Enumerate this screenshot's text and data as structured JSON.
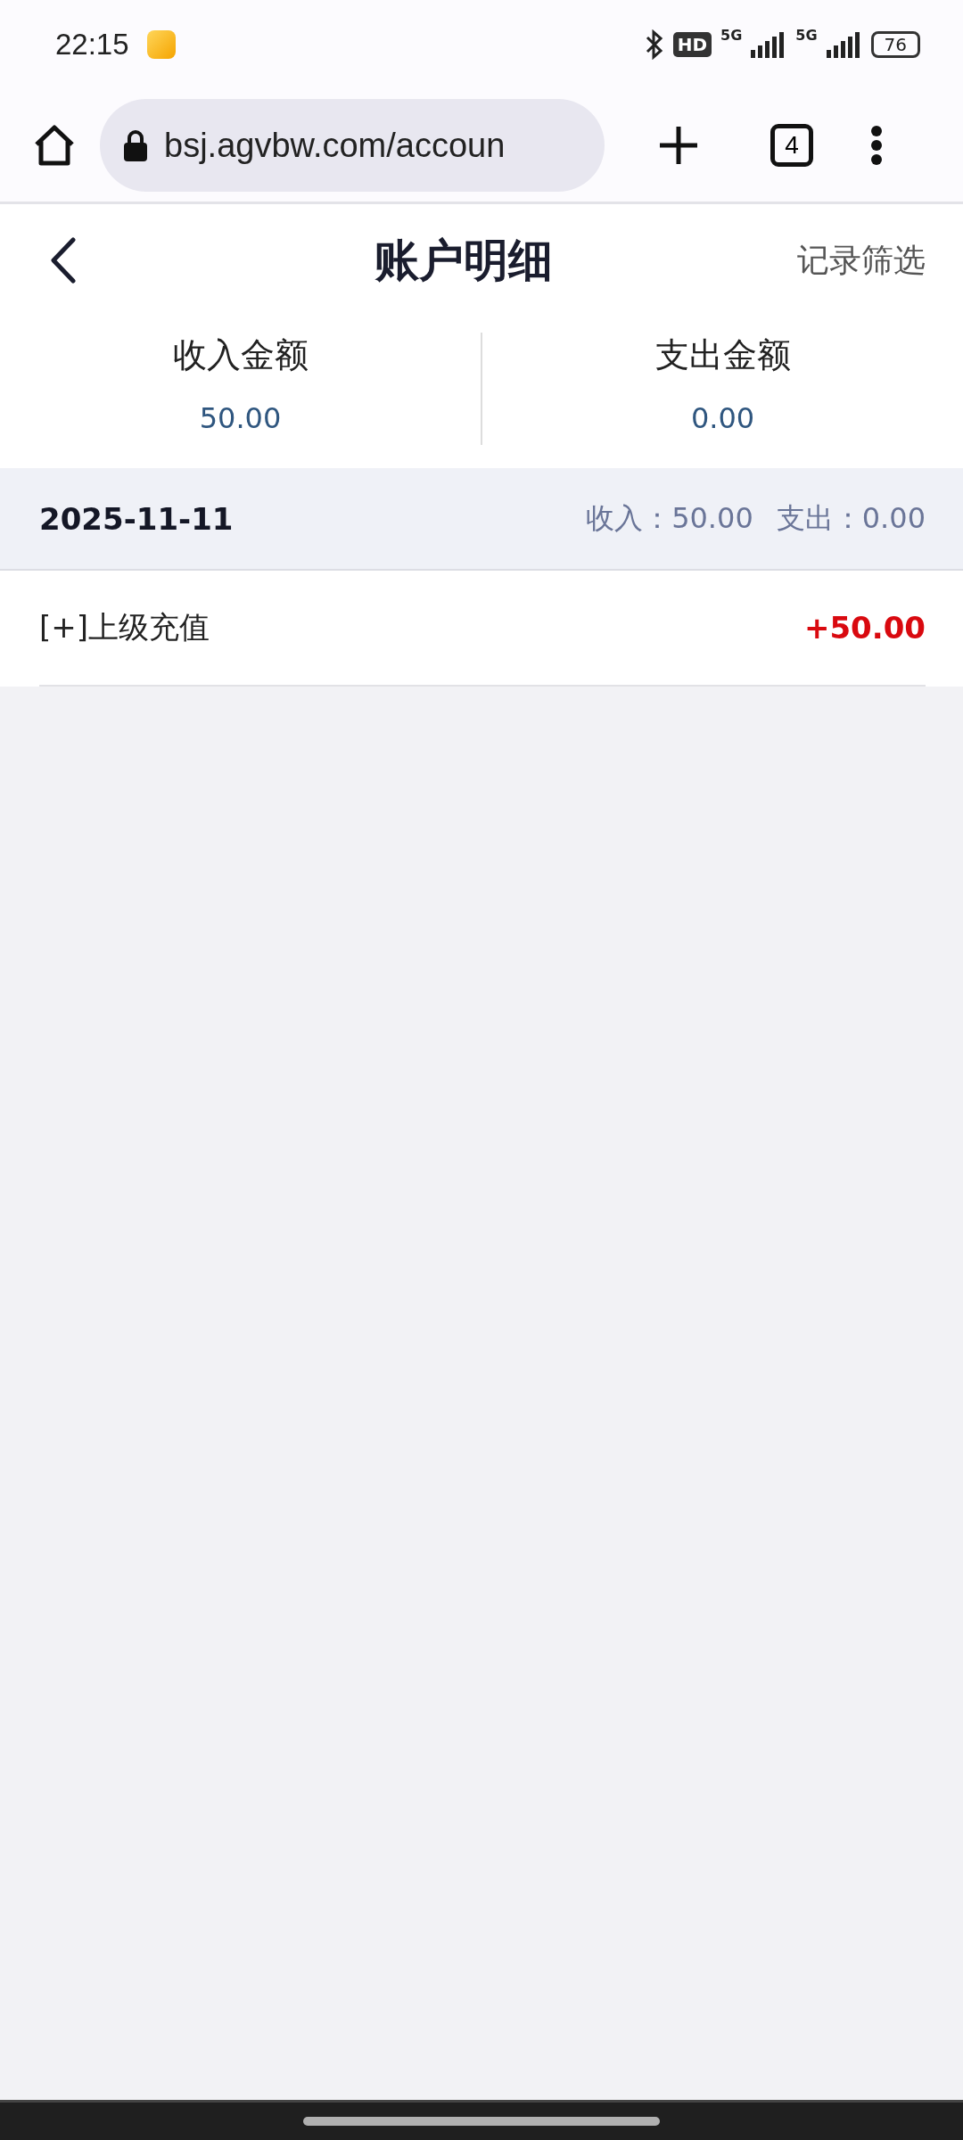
{
  "status_bar": {
    "time": "22:15",
    "hd_label": "HD",
    "network_1": "5G",
    "network_2": "5G",
    "battery": "76"
  },
  "browser": {
    "url": "bsj.agvbw.com/accoun",
    "tab_count": "4"
  },
  "header": {
    "title": "账户明细",
    "filter_link": "记录筛选"
  },
  "summary": [
    {
      "label": "收入金额",
      "value": "50.00"
    },
    {
      "label": "支出金额",
      "value": "0.00"
    }
  ],
  "days": [
    {
      "date": "2025-11-11",
      "income": "收入：50.00",
      "expense": "支出：0.00",
      "records": [
        {
          "title": "[+]上级充值",
          "amount": "+50.00",
          "kind": "income"
        }
      ]
    }
  ]
}
